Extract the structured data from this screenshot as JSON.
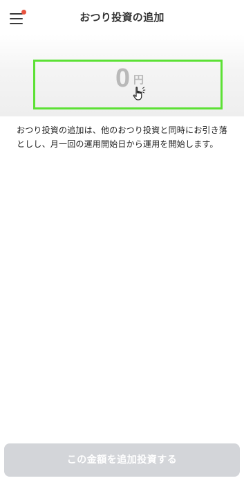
{
  "header": {
    "title": "おつり投資の追加",
    "menu_icon": "hamburger-menu-icon",
    "notification_color": "#e8533f"
  },
  "amount": {
    "value": "0",
    "unit": "円",
    "tap_icon": "pointing-hand-icon",
    "highlight_color": "#5ce135"
  },
  "description": {
    "text": "おつり投資の追加は、他のおつり投資と同時にお引き落としし、月一回の運用開始日から運用を開始します。"
  },
  "footer": {
    "submit_label": "この金額を追加投資する",
    "submit_enabled": false
  }
}
